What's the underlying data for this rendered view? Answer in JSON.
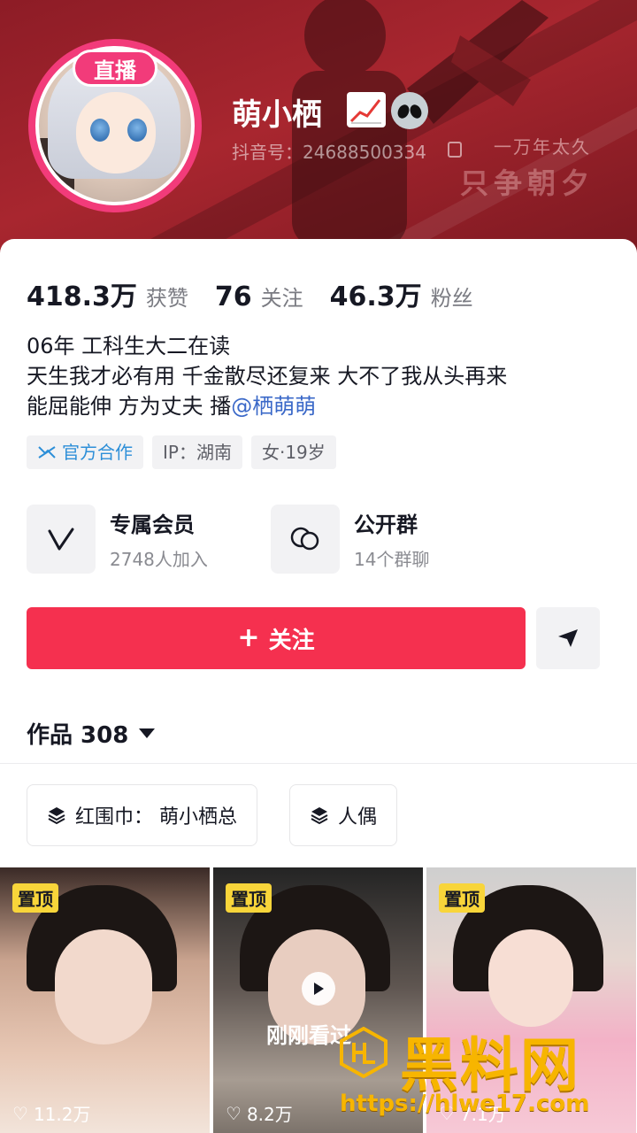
{
  "header": {
    "live_badge": "直播",
    "nickname": "萌小栖",
    "nickname_icons": [
      "chart-increasing-icon",
      "alien-icon"
    ],
    "douyin_id": "抖音号：24688500334",
    "background_slogan_line1": "一万年太久",
    "background_slogan_line2": "只争朝夕"
  },
  "stats": [
    {
      "value": "418.3万",
      "label": "获赞"
    },
    {
      "value": "76",
      "label": "关注"
    },
    {
      "value": "46.3万",
      "label": "粉丝"
    }
  ],
  "bio": {
    "line1": "06年  工科生大二在读",
    "line2": "天生我才必有用 千金散尽还复来 大不了我从头再来",
    "line3_text": "能屈能伸 方为丈夫  播",
    "line3_link": "@栖萌萌"
  },
  "tags": {
    "official": "官方合作",
    "ip": "IP：湖南",
    "gender_age": "女·19岁"
  },
  "features": {
    "member": {
      "title": "专属会员",
      "subtitle": "2748人加入",
      "icon": "v-icon"
    },
    "group": {
      "title": "公开群",
      "subtitle": "14个群聊",
      "icon": "chat-bubbles-icon"
    }
  },
  "actions": {
    "follow_label": "关注",
    "share_icon": "send-icon"
  },
  "works": {
    "tab_label": "作品 308"
  },
  "collections": [
    {
      "label": "红围巾：  萌小栖总",
      "icon": "layers-icon"
    },
    {
      "label": "人偶",
      "icon": "layers-icon"
    }
  ],
  "videos": [
    {
      "pinned": "置顶",
      "likes": "11.2万"
    },
    {
      "pinned": "置顶",
      "likes": "8.2万",
      "overlay": "刚刚看过"
    },
    {
      "pinned": "置顶",
      "likes": "7.1万"
    }
  ],
  "watermark": {
    "brand": "黑料网",
    "url": "https://hlwe17.com"
  },
  "colors": {
    "banner": "#a8262f",
    "live_pink": "#f23b7a",
    "follow_red": "#f5304f",
    "link_blue": "#3a68c8",
    "pin_yellow": "#f8d53a",
    "watermark_gold": "#f7b500"
  }
}
